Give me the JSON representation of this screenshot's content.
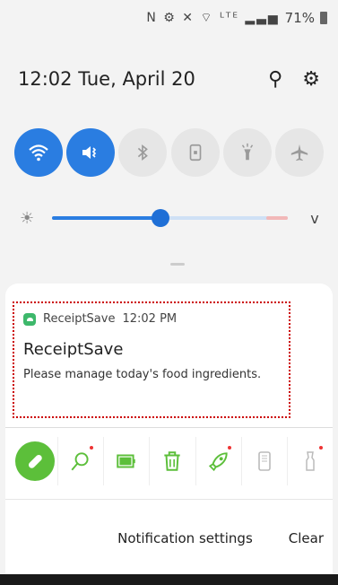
{
  "status": {
    "icons_text": "N ⚙ ✕ ⌔ ᴸᵀᴱ ▂▃▅",
    "battery": "71%"
  },
  "header": {
    "time": "12:02",
    "date": "Tue, April 20",
    "search_icon": "search-icon",
    "settings_icon": "gear-icon"
  },
  "quick_toggles": [
    {
      "name": "wifi",
      "icon": "wifi-icon",
      "glyph": "≋",
      "state": "on"
    },
    {
      "name": "sound",
      "icon": "vibrate-icon",
      "glyph": "📳",
      "state": "on"
    },
    {
      "name": "bluetooth",
      "icon": "bluetooth-icon",
      "glyph": "ᛒ",
      "state": "off"
    },
    {
      "name": "rotation",
      "icon": "rotation-lock-icon",
      "glyph": "▣",
      "state": "off"
    },
    {
      "name": "flashlight",
      "icon": "flashlight-icon",
      "glyph": "🔦",
      "state": "off"
    },
    {
      "name": "airplane",
      "icon": "airplane-icon",
      "glyph": "✈",
      "state": "off"
    }
  ],
  "brightness": {
    "level": 0.46,
    "icon": "brightness-icon",
    "expand_glyph": "v"
  },
  "notification": {
    "app_name": "ReceiptSave",
    "time": "12:02 PM",
    "title": "ReceiptSave",
    "body": "Please manage today's food ingredients."
  },
  "app_shortcuts": [
    {
      "icon": "pill-icon",
      "glyph": "💊",
      "color": "#5cbf3a"
    },
    {
      "icon": "search-magnifier-icon",
      "glyph": "🔍",
      "color": "#5cbf3a",
      "dot": true
    },
    {
      "icon": "battery-icon",
      "glyph": "▮",
      "color": "#5cbf3a"
    },
    {
      "icon": "trash-icon",
      "glyph": "🗑",
      "color": "#5cbf3a"
    },
    {
      "icon": "rocket-icon",
      "glyph": "🚀",
      "color": "#5cbf3a",
      "dot": true
    },
    {
      "icon": "phone-icon",
      "glyph": "📱",
      "color": "#bbb"
    },
    {
      "icon": "flashlight-small-icon",
      "glyph": "🔦",
      "color": "#bbb",
      "dot": true
    }
  ],
  "footer": {
    "settings_label": "Notification settings",
    "clear_label": "Clear"
  },
  "colors": {
    "accent": "#2a7de1",
    "highlight_border": "#cc0000",
    "app_green": "#5cbf3a"
  }
}
